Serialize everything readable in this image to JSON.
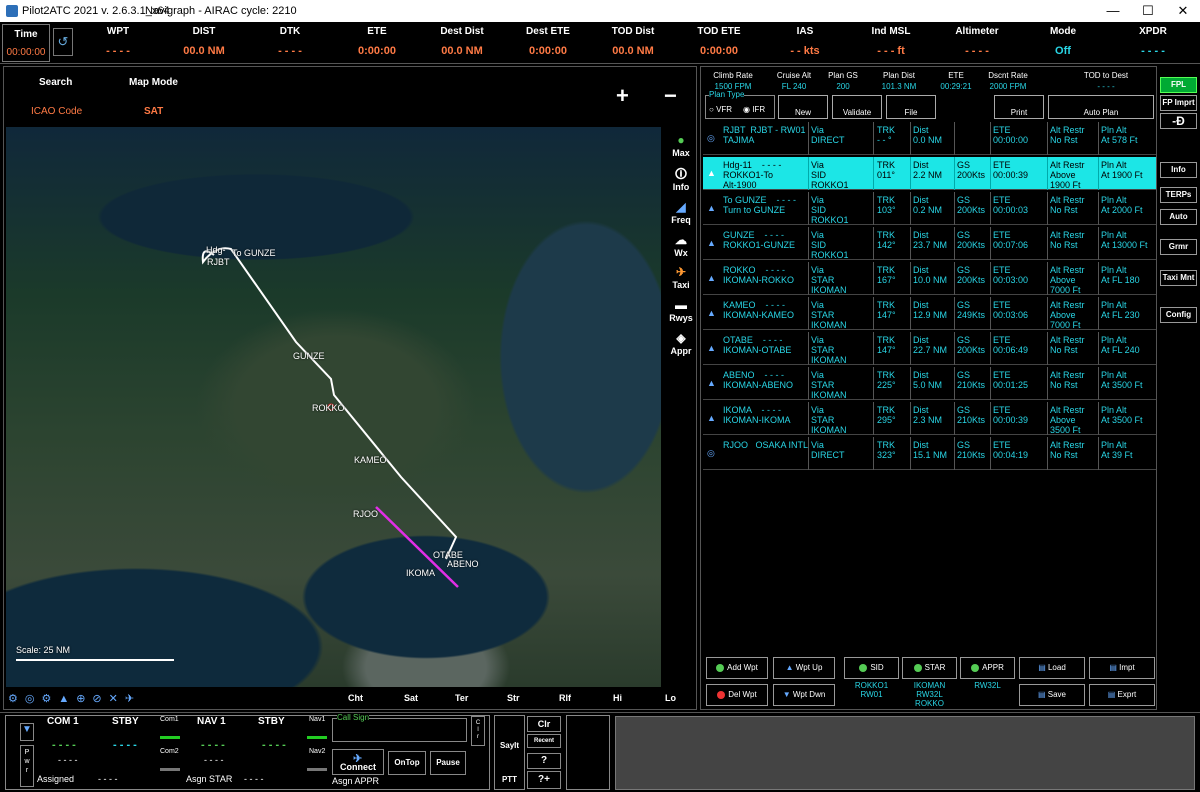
{
  "window": {
    "title": "Pilot2ATC 2021 v. 2.6.3.1_x64",
    "nav": "Navigraph - AIRAC cycle: 2210",
    "min": "—",
    "max": "☐",
    "close": "✕"
  },
  "top": {
    "time_label": "Time",
    "time_value": "00:00:00",
    "cols": [
      {
        "label": "WPT",
        "value": "- - - -"
      },
      {
        "label": "DIST",
        "value": "00.0 NM"
      },
      {
        "label": "DTK",
        "value": "- - - -"
      },
      {
        "label": "ETE",
        "value": "0:00:00"
      },
      {
        "label": "Dest Dist",
        "value": "00.0 NM"
      },
      {
        "label": "Dest ETE",
        "value": "0:00:00"
      },
      {
        "label": "TOD Dist",
        "value": "00.0 NM"
      },
      {
        "label": "TOD ETE",
        "value": "0:00:00"
      },
      {
        "label": "IAS",
        "value": "- - kts"
      },
      {
        "label": "Ind MSL",
        "value": "- - - ft"
      },
      {
        "label": "Altimeter",
        "value": "- - - -"
      },
      {
        "label": "Mode",
        "value": "Off"
      },
      {
        "label": "XPDR",
        "value": "- - - -"
      }
    ]
  },
  "map": {
    "search_label": "Search",
    "mode_label": "Map Mode",
    "icao_label": "ICAO Code",
    "mode_value": "SAT",
    "zoom_in": "+",
    "zoom_out": "−",
    "waypoints": [
      "Hdg-",
      "RJBT",
      "To GUNZE",
      "GUNZE",
      "ROKKO",
      "KAMEO",
      "RJOO",
      "OTABE",
      "ABENO",
      "IKOMA"
    ],
    "scale": "Scale: 25 NM",
    "tools": [
      "Max",
      "Info",
      "Freq",
      "Wx",
      "Taxi",
      "Rwys",
      "Appr"
    ],
    "tabs": [
      "Cht",
      "Sat",
      "Ter",
      "Str",
      "Rlf",
      "Hi",
      "Lo"
    ]
  },
  "fpl": {
    "stats": [
      {
        "label": "Climb Rate",
        "value": "1500 FPM"
      },
      {
        "label": "Cruise Alt",
        "value": "FL 240"
      },
      {
        "label": "Plan GS",
        "value": "200"
      },
      {
        "label": "Plan Dist",
        "value": "101.3 NM"
      },
      {
        "label": "ETE",
        "value": "00:29:21"
      },
      {
        "label": "Dscnt Rate",
        "value": "2000 FPM"
      },
      {
        "label": "TOD to Dest",
        "value": "- - - -"
      }
    ],
    "plan_type": "Plan Type",
    "vfr": "VFR",
    "ifr": "IFR",
    "buttons": {
      "new": "New",
      "validate": "Validate",
      "file": "File",
      "print": "Print",
      "auto_plan": "Auto Plan"
    },
    "rows": [
      {
        "c1": "RJBT  RJBT - RW01\nTAJIMA",
        "c2": "Via\nDIRECT",
        "c3": "TRK\n- - °",
        "c4": "Dist\n0.0 NM",
        "c5": "",
        "c6": "ETE\n00:00:00",
        "c7": "Alt Restr\nNo Rst",
        "c8": "Pln Alt\nAt 578 Ft"
      },
      {
        "c1": "Hdg-11    - - - -\nROKKO1-To\nAlt-1900",
        "c2": "Via\nSID\nROKKO1",
        "c3": "TRK\n011°",
        "c4": "Dist\n2.2 NM",
        "c5": "GS\n200Kts",
        "c6": "ETE\n00:00:39",
        "c7": "Alt Restr\nAbove\n1900 Ft",
        "c8": "Pln Alt\nAt 1900 Ft"
      },
      {
        "c1": "To GUNZE    - - - -\nTurn to GUNZE",
        "c2": "Via\nSID\nROKKO1",
        "c3": "TRK\n103°",
        "c4": "Dist\n0.2 NM",
        "c5": "GS\n200Kts",
        "c6": "ETE\n00:00:03",
        "c7": "Alt Restr\nNo Rst",
        "c8": "Pln Alt\nAt 2000 Ft"
      },
      {
        "c1": "GUNZE    - - - -\nROKKO1-GUNZE",
        "c2": "Via\nSID\nROKKO1",
        "c3": "TRK\n142°",
        "c4": "Dist\n23.7 NM",
        "c5": "GS\n200Kts",
        "c6": "ETE\n00:07:06",
        "c7": "Alt Restr\nNo Rst",
        "c8": "Pln Alt\nAt 13000 Ft"
      },
      {
        "c1": "ROKKO    - - - -\nIKOMAN-ROKKO",
        "c2": "Via\nSTAR\nIKOMAN",
        "c3": "TRK\n167°",
        "c4": "Dist\n10.0 NM",
        "c5": "GS\n200Kts",
        "c6": "ETE\n00:03:00",
        "c7": "Alt Restr\nAbove\n7000 Ft",
        "c8": "Pln Alt\nAt FL 180"
      },
      {
        "c1": "KAMEO    - - - -\nIKOMAN-KAMEO",
        "c2": "Via\nSTAR\nIKOMAN",
        "c3": "TRK\n147°",
        "c4": "Dist\n12.9 NM",
        "c5": "GS\n249Kts",
        "c6": "ETE\n00:03:06",
        "c7": "Alt Restr\nAbove\n7000 Ft",
        "c8": "Pln Alt\nAt FL 230"
      },
      {
        "c1": "OTABE    - - - -\nIKOMAN-OTABE",
        "c2": "Via\nSTAR\nIKOMAN",
        "c3": "TRK\n147°",
        "c4": "Dist\n22.7 NM",
        "c5": "GS\n200Kts",
        "c6": "ETE\n00:06:49",
        "c7": "Alt Restr\nNo Rst",
        "c8": "Pln Alt\nAt FL 240"
      },
      {
        "c1": "ABENO    - - - -\nIKOMAN-ABENO",
        "c2": "Via\nSTAR\nIKOMAN",
        "c3": "TRK\n225°",
        "c4": "Dist\n5.0 NM",
        "c5": "GS\n210Kts",
        "c6": "ETE\n00:01:25",
        "c7": "Alt Restr\nNo Rst",
        "c8": "Pln Alt\nAt 3500 Ft"
      },
      {
        "c1": "IKOMA    - - - -\nIKOMAN-IKOMA",
        "c2": "Via\nSTAR\nIKOMAN",
        "c3": "TRK\n295°",
        "c4": "Dist\n2.3 NM",
        "c5": "GS\n210Kts",
        "c6": "ETE\n00:00:39",
        "c7": "Alt Restr\nAbove\n3500 Ft",
        "c8": "Pln Alt\nAt 3500 Ft"
      },
      {
        "c1": "RJOO   OSAKA INTL",
        "c2": "Via\nDIRECT",
        "c3": "TRK\n323°",
        "c4": "Dist\n15.1 NM",
        "c5": "GS\n210Kts",
        "c6": "ETE\n00:04:19",
        "c7": "Alt Restr\nNo Rst",
        "c8": "Pln Alt\nAt 39 Ft"
      }
    ],
    "bottom": {
      "add": "Add Wpt",
      "wpt_up": "Wpt Up",
      "sid": "SID",
      "star": "STAR",
      "appr": "APPR",
      "load": "Load",
      "impt": "Impt",
      "del": "Del Wpt",
      "wpt_dwn": "Wpt Dwn",
      "sid_val": "ROKKO1\nRW01",
      "star_val": "IKOMAN\nRW32L\nROKKO",
      "appr_val": "RW32L",
      "save": "Save",
      "exprt": "Exprt"
    }
  },
  "right_buttons": [
    "FPL",
    "FP Imprt",
    "Info",
    "TERPs",
    "Auto",
    "Grmr",
    "Taxi Mnt",
    "Config"
  ],
  "radio": {
    "com1": "COM 1",
    "stby1": "STBY",
    "com1_val": "- - - -",
    "stby1_val": "- - - -",
    "com1_small": "Com1",
    "com2_small": "Com2",
    "nav1": "NAV 1",
    "stby2": "STBY",
    "nav1_val": "- - - -",
    "stby2_val": "- - - -",
    "nav1_small": "Nav1",
    "nav2_small": "Nav2",
    "com2_val": "- - - -",
    "nav2_val": "- - - -",
    "assigned": "Assigned",
    "assigned_val": "- - - -",
    "asgn_star": "Asgn STAR",
    "asgn_star_val": "- - - -",
    "asgn_appr": "Asgn APPR",
    "pwr": "P\nw\nr",
    "call_sign": "Call Sign",
    "connect": "Connect",
    "ontop": "OnTop",
    "pause": "Pause",
    "clr_side": "C\nl\nr",
    "sayit": "SayIt",
    "clr": "Clr",
    "recent": "Recent",
    "ptt": "PTT",
    "q": "?",
    "qplus": "?+"
  }
}
